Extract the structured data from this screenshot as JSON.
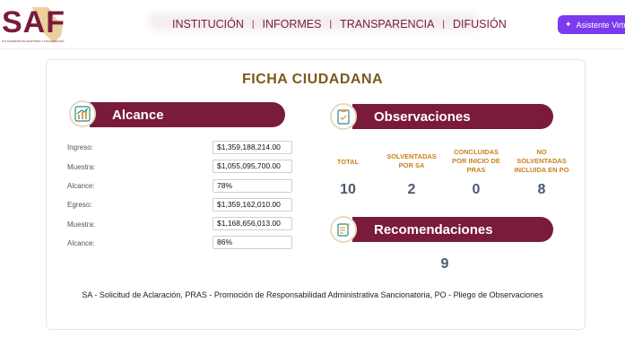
{
  "header": {
    "logo_text": "SAF",
    "logo_subtitle": "ITO SUPERIOR DE AUDITORIA Y FISCALIZACIÓN",
    "nav": [
      "INSTITUCIÓN",
      "INFORMES",
      "TRANSPARENCIA",
      "DIFUSIÓN"
    ],
    "assistant_button": "Asistente Virtu",
    "colors": {
      "brand": "#7a1b3a",
      "assistant": "#7c3aed"
    }
  },
  "main": {
    "title": "FICHA CIUDADANA",
    "alcance": {
      "heading": "Alcance",
      "rows": [
        {
          "label": "Ingreso:",
          "value": "$1,359,188,214.00"
        },
        {
          "label": "Muestra:",
          "value": "$1,055,095,700.00"
        },
        {
          "label": "Alcance:",
          "value": "78%"
        },
        {
          "label": "Egreso:",
          "value": "$1,359,162,010.00"
        },
        {
          "label": "Muestra:",
          "value": "$1,168,656,013.00"
        },
        {
          "label": "Alcance:",
          "value": "86%"
        }
      ]
    },
    "observaciones": {
      "heading": "Observaciones",
      "columns": [
        {
          "label": "TOTAL",
          "value": "10"
        },
        {
          "label": "SOLVENTADAS POR SA",
          "value": "2"
        },
        {
          "label": "CONCLUIDAS POR INICIO DE PRAS",
          "value": "0"
        },
        {
          "label": "NO SOLVENTADAS INCLUIDA EN PO",
          "value": "8"
        }
      ]
    },
    "recomendaciones": {
      "heading": "Recomendaciones",
      "value": "9"
    },
    "footnote": "SA - Solicitud de Aclaración, PRAS - Promoción de Responsabilidad Administrativa Sancionatoria, PO - Pliego de Observaciones"
  }
}
